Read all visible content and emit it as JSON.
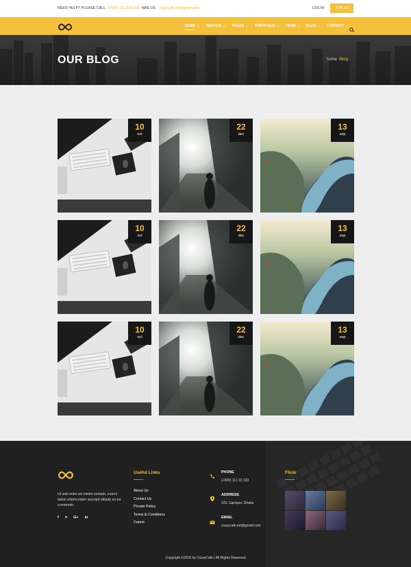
{
  "topbar": {
    "need_help": "NEED HELP? PLEASE CALL",
    "phone": "(+000) 111 222 333",
    "mail_label": "MAIL US",
    "email": "crazycafe.net@gmail.com",
    "login": "LOG IN",
    "join": "JOIN US"
  },
  "nav": {
    "items": [
      {
        "label": "HOME",
        "active": true
      },
      {
        "label": "SERVICE"
      },
      {
        "label": "PAGES"
      },
      {
        "label": "PORTFOLIO"
      },
      {
        "label": "TEAM"
      },
      {
        "label": "BLOG"
      },
      {
        "label": "CONTACT"
      }
    ],
    "caret": "⌄"
  },
  "hero": {
    "title": "OUR BLOG",
    "breadcrumb_home": "home",
    "breadcrumb_current": "/blog"
  },
  "posts": [
    {
      "day": "10",
      "month": "oct",
      "image": "desk"
    },
    {
      "day": "22",
      "month": "dec",
      "image": "street"
    },
    {
      "day": "13",
      "month": "sep",
      "image": "fjord"
    },
    {
      "day": "10",
      "month": "oct",
      "image": "desk"
    },
    {
      "day": "22",
      "month": "dec",
      "image": "street"
    },
    {
      "day": "13",
      "month": "sep",
      "image": "fjord"
    },
    {
      "day": "10",
      "month": "oct",
      "image": "desk"
    },
    {
      "day": "22",
      "month": "dec",
      "image": "street"
    },
    {
      "day": "13",
      "month": "sep",
      "image": "fjord"
    }
  ],
  "footer": {
    "about_text": "Ut wisi enim ad minim veniam, exerci tation ullamcorper suscipit aliquip ex ea commodo.",
    "social": [
      "f",
      "♥",
      "G+",
      "in"
    ],
    "useful_links_title": "Useful Links",
    "links": [
      "About Us",
      "Contact Us",
      "Private Policy",
      "Terms & Conditions",
      "Career"
    ],
    "contact": [
      {
        "icon": "phone-icon",
        "title": "PHONE",
        "value": "(+000) 111 22 333"
      },
      {
        "icon": "location-icon",
        "title": "ADDRESS",
        "value": "123, Sarmpur, Dhaka"
      },
      {
        "icon": "mail-icon",
        "title": "EMAIL",
        "value": "crazycafe.net@gmail.com"
      }
    ],
    "flickr_title": "Flickr",
    "copyright": "Copyright ©2016 by CrazyCafe   |   All Rights Reserved"
  },
  "colors": {
    "accent": "#f5c03c",
    "dark": "#202020"
  }
}
